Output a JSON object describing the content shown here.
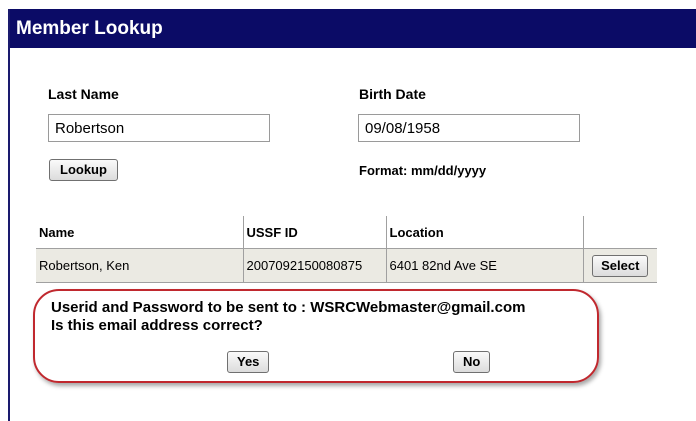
{
  "window": {
    "title": "Member Lookup"
  },
  "form": {
    "last_name_label": "Last Name",
    "last_name_value": "Robertson",
    "birth_date_label": "Birth Date",
    "birth_date_value": "09/08/1958",
    "lookup_label": "Lookup",
    "format_hint": "Format: mm/dd/yyyy"
  },
  "results": {
    "columns": [
      "Name",
      "USSF ID",
      "Location",
      ""
    ],
    "rows": [
      {
        "name": "Robertson, Ken",
        "ussf_id": "2007092150080875",
        "location": "6401 82nd Ave SE",
        "select_label": "Select"
      }
    ]
  },
  "confirm": {
    "line1": "Userid and Password to be sent to : WSRCWebmaster@gmail.com",
    "line2": "Is this email address correct?",
    "yes_label": "Yes",
    "no_label": "No"
  },
  "colors": {
    "titlebar": "#0b0b66",
    "row_bg": "#ebeae3",
    "callout": "#c0282e"
  }
}
